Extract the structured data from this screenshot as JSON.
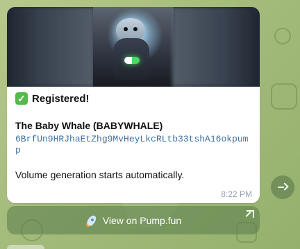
{
  "message": {
    "status_text": "Registered!",
    "token_title": "The Baby Whale (BABYWHALE)",
    "token_address": "6BrfUn9HRJhaEtZhg9MvHeyLkcRLtb33tshA16okpump",
    "volume_text": "Volume generation starts automatically.",
    "timestamp": "8:22 PM"
  },
  "link_button": {
    "label": "View on Pump.fun"
  },
  "icons": {
    "status": "check-icon",
    "rocket": "rocket-icon",
    "external": "external-link-icon",
    "share": "share-icon"
  },
  "colors": {
    "bubble": "#ffffff",
    "address": "#3d6f9c",
    "background": "#a7be7e",
    "check": "#55b94b"
  }
}
